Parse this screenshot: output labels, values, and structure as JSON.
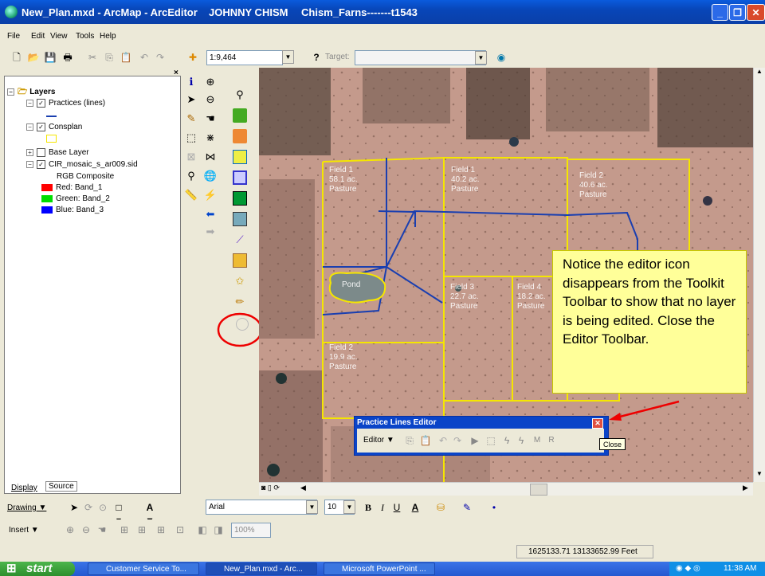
{
  "window": {
    "title_file": "New_Plan.mxd - ArcMap - ArcEditor",
    "title_user": "JOHNNY CHISM",
    "title_farm": "Chism_Farns-------t1543"
  },
  "menu": [
    "File",
    "Edit",
    "View",
    "Tools",
    "Help"
  ],
  "standard_toolbar": {
    "scale_value": "1:9,464",
    "target_label": "Target:"
  },
  "toc": {
    "root": "Layers",
    "items": [
      {
        "label": "Practices (lines)"
      },
      {
        "label": "Consplan"
      },
      {
        "label": "Base Layer"
      },
      {
        "label": "CIR_mosaic_s_ar009.sid"
      },
      {
        "label": "RGB Composite"
      },
      {
        "label": "Red:   Band_1",
        "color": "#ff0000"
      },
      {
        "label": "Green: Band_2",
        "color": "#00dd00"
      },
      {
        "label": "Blue:   Band_3",
        "color": "#0000ff"
      }
    ],
    "tabs": [
      "Display",
      "Source"
    ]
  },
  "map": {
    "fields": [
      {
        "name": "Field 1",
        "acres": "58.1 ac.",
        "use": "Pasture"
      },
      {
        "name": "Field 1",
        "acres": "40.2 ac.",
        "use": "Pasture"
      },
      {
        "name": "Field 2",
        "acres": "40.6 ac.",
        "use": "Pasture"
      },
      {
        "name": "Field 3",
        "acres": "22.7 ac.",
        "use": "Pasture"
      },
      {
        "name": "Field 4",
        "acres": "18.2 ac.",
        "use": "Pasture"
      },
      {
        "name": "Field 2",
        "acres": "19.9 ac.",
        "use": "Pasture"
      }
    ],
    "pond_label": "Pond",
    "boundary_color": "#f5e600",
    "practice_line_color": "#1a3fb0"
  },
  "callout": {
    "text": "Notice the editor icon disappears from the Toolkit Toolbar to show that no layer is being edited. Close the Editor Toolbar."
  },
  "editor_toolbar": {
    "title": "Practice Lines Editor",
    "editor_menu": "Editor ▼",
    "tooltip": "Close"
  },
  "drawing_toolbar": {
    "drawing_label": "Drawing ▼",
    "font_name": "Arial",
    "font_size": "10"
  },
  "insert_toolbar": {
    "insert_label": "Insert ▼",
    "zoom_value": "100%"
  },
  "status": {
    "coordinates": "1625133.71  13133652.99 Feet"
  },
  "taskbar": {
    "start": "start",
    "tasks": [
      "Customer Service To...",
      "New_Plan.mxd - Arc...",
      "Microsoft PowerPoint ..."
    ],
    "clock": "11:38 AM"
  }
}
